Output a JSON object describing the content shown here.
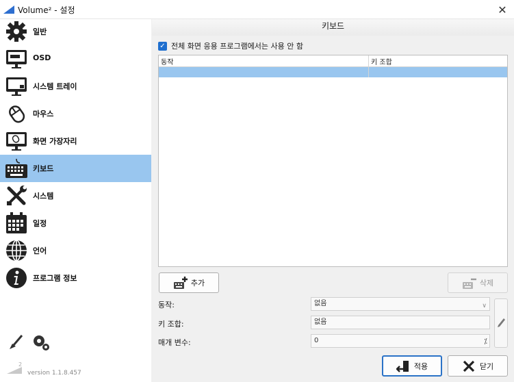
{
  "window": {
    "title": "Volume² - 설정",
    "close_glyph": "✕"
  },
  "sidebar": {
    "items": [
      {
        "label": "일반",
        "icon": "gear-icon"
      },
      {
        "label": "OSD",
        "icon": "monitor-icon"
      },
      {
        "label": "시스템 트레이",
        "icon": "tray-monitor-icon"
      },
      {
        "label": "마우스",
        "icon": "mouse-icon"
      },
      {
        "label": "화면 가장자리",
        "icon": "screen-edge-icon"
      },
      {
        "label": "키보드",
        "icon": "keyboard-icon",
        "active": true
      },
      {
        "label": "시스템",
        "icon": "tools-icon"
      },
      {
        "label": "일정",
        "icon": "calendar-icon"
      },
      {
        "label": "언어",
        "icon": "globe-icon"
      },
      {
        "label": "프로그램 정보",
        "icon": "info-icon"
      }
    ],
    "version_mark": "2",
    "version": "version 1.1.8.457"
  },
  "panel": {
    "title": "키보드",
    "fullscreen_checkbox": {
      "label": "전체 화면 응용 프로그램에서는 사용 안 함",
      "checked": true
    },
    "grid": {
      "columns": [
        "동작",
        "키 조합"
      ]
    },
    "add_button": "추가",
    "delete_button": "삭제",
    "form": {
      "action_label": "동작:",
      "action_value": "없음",
      "hotkey_label": "키 조합:",
      "hotkey_value": "없음",
      "param_label": "매개 변수:",
      "param_value": "0"
    }
  },
  "footer": {
    "apply_label": "적용",
    "close_label": "닫기"
  },
  "colors": {
    "accent": "#99c6ef",
    "checkbox": "#1f6fcf"
  }
}
